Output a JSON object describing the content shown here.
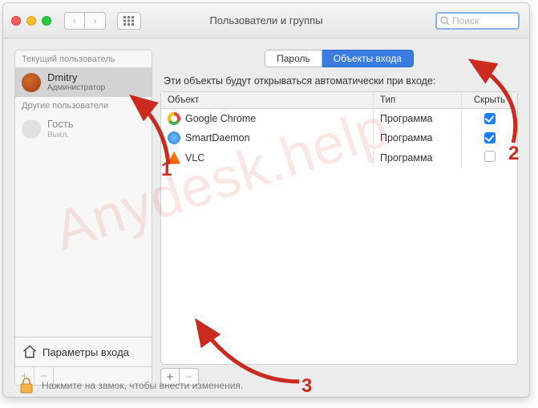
{
  "window": {
    "title": "Пользователи и группы"
  },
  "search": {
    "placeholder": "Поиск"
  },
  "sidebar": {
    "headers": {
      "current": "Текущий пользователь",
      "other": "Другие пользователи"
    },
    "current": {
      "name": "Dmitry",
      "role": "Администратор"
    },
    "guest": {
      "name": "Гость",
      "role": "Выкл."
    },
    "login_options": "Параметры входа"
  },
  "tabs": {
    "password": "Пароль",
    "login_items": "Объекты входа"
  },
  "main": {
    "desc": "Эти объекты будут открываться автоматически при входе:",
    "columns": {
      "object": "Объект",
      "type": "Тип",
      "hide": "Скрыть"
    },
    "rows": [
      {
        "icon": "ic-chrome",
        "name": "Google Chrome",
        "type": "Программа",
        "hide": true
      },
      {
        "icon": "ic-daemon",
        "name": "SmartDaemon",
        "type": "Программа",
        "hide": true
      },
      {
        "icon": "ic-vlc",
        "name": "VLC",
        "type": "Программа",
        "hide": false
      }
    ]
  },
  "lock": {
    "text": "Нажмите на замок, чтобы внести изменения."
  },
  "annotations": {
    "n1": "1",
    "n2": "2",
    "n3": "3"
  },
  "watermark": "Anydesk.help"
}
